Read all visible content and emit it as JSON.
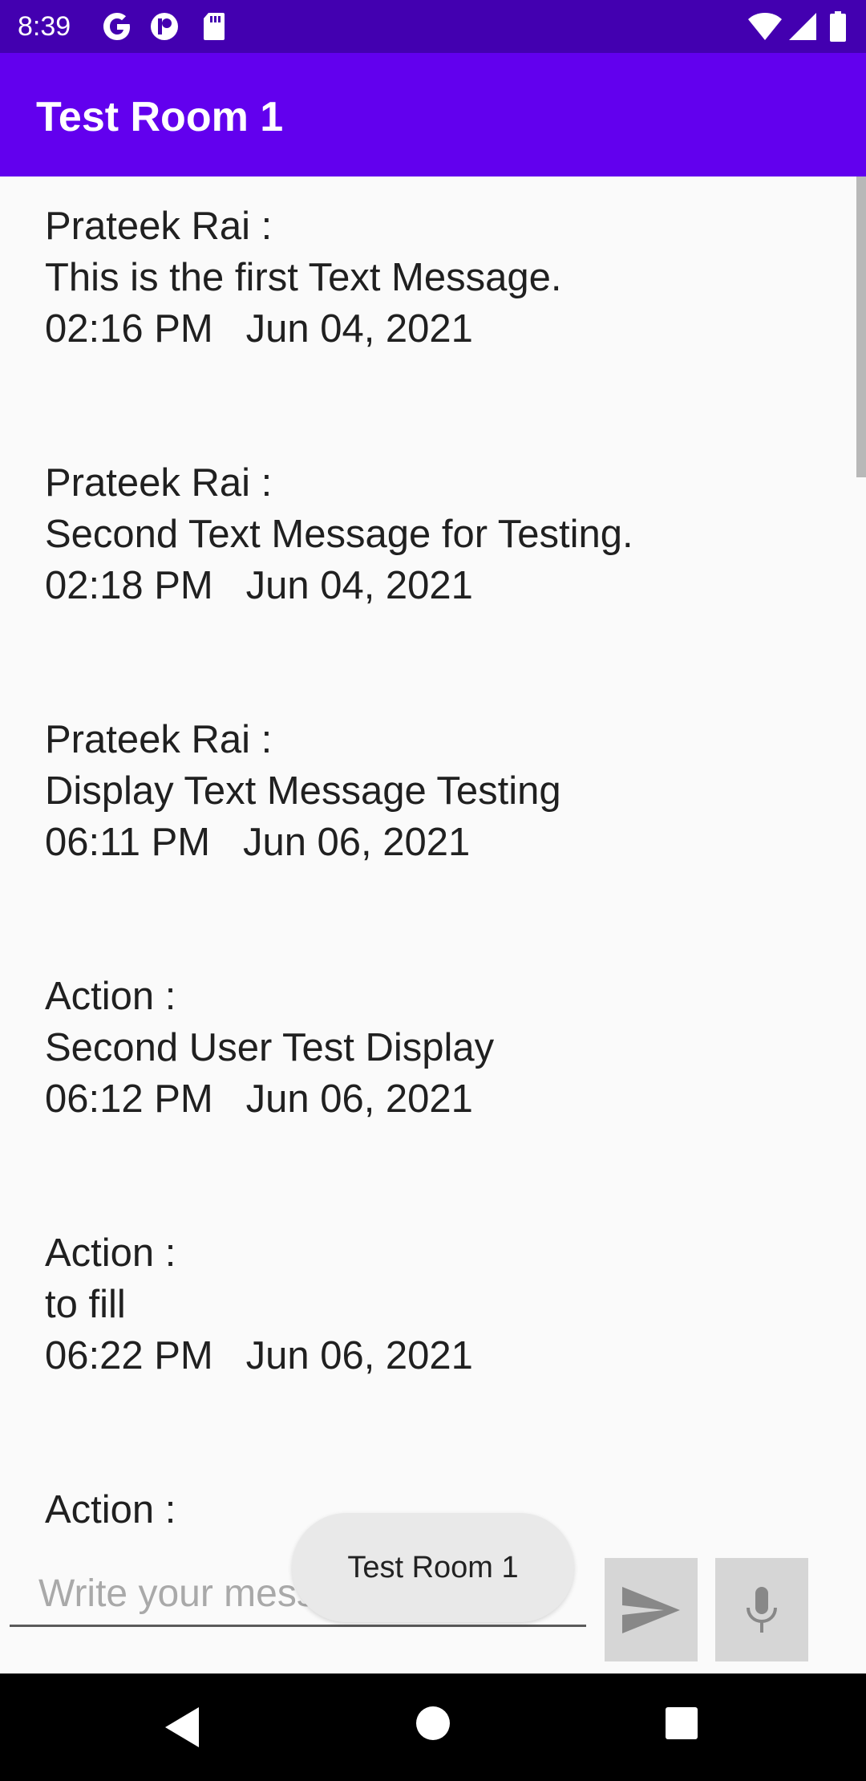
{
  "status_bar": {
    "time": "8:39",
    "app_icons": [
      "google-g-icon",
      "app-notification-icon",
      "sd-card-icon"
    ],
    "system_icons": [
      "wifi-icon",
      "signal-icon",
      "battery-icon"
    ]
  },
  "app_bar": {
    "title": "Test Room 1",
    "color": "#6200ee"
  },
  "messages": [
    {
      "sender": "Prateek Rai :",
      "text": "This is the first Text Message.",
      "timestamp": "02:16 PM   Jun 04, 2021"
    },
    {
      "sender": "Prateek Rai :",
      "text": "Second Text Message for Testing.",
      "timestamp": "02:18 PM   Jun 04, 2021"
    },
    {
      "sender": "Prateek Rai :",
      "text": "Display Text Message Testing",
      "timestamp": "06:11 PM   Jun 06, 2021"
    },
    {
      "sender": "Action :",
      "text": "Second User Test Display",
      "timestamp": "06:12 PM   Jun 06, 2021"
    },
    {
      "sender": "Action :",
      "text": "to fill",
      "timestamp": "06:22 PM   Jun 06, 2021"
    },
    {
      "sender": "Action :",
      "text": "",
      "timestamp": ""
    }
  ],
  "composer": {
    "placeholder": "Write your message...",
    "value": "",
    "send_icon": "send-icon",
    "mic_icon": "mic-icon"
  },
  "toast": {
    "text": "Test Room 1"
  },
  "nav_bar": {
    "icons": [
      "back-icon",
      "home-icon",
      "recents-icon"
    ]
  }
}
